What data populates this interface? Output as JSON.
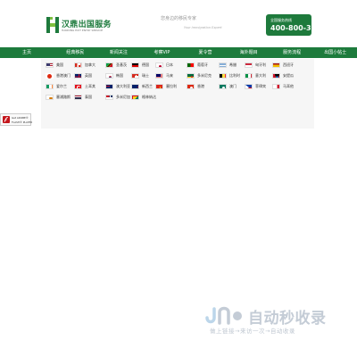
{
  "header": {
    "logo_title": "汉鼎出国服务",
    "logo_subtitle": "HANDING EXIT ENTRY SERVICE",
    "slogan": "您身边的移民专家",
    "slogan_en": "Your Immigration Expert",
    "hotline_label": "全国服务热线",
    "hotline_number": "400-800-3337"
  },
  "nav": {
    "items": [
      "主页",
      "经典移民",
      "新闻关注",
      "考察VIP",
      "夏令营",
      "海外题目",
      "服务流程",
      "出国小帖士"
    ]
  },
  "countries": [
    {
      "label": "美国",
      "flag": "us"
    },
    {
      "label": "加拿大",
      "flag": "ca"
    },
    {
      "label": "圣基茨",
      "flag": "kn"
    },
    {
      "label": "德国",
      "flag": "de"
    },
    {
      "label": "日本",
      "flag": "jp"
    },
    {
      "label": "葡萄牙",
      "flag": "pt"
    },
    {
      "label": "希腊",
      "flag": "gr"
    },
    {
      "label": "匈牙利",
      "flag": "hu"
    },
    {
      "label": "西班牙",
      "flag": "es"
    },
    {
      "label": "香港澳门",
      "flag": "hk"
    },
    {
      "label": "英国",
      "flag": "gb"
    },
    {
      "label": "韩国",
      "flag": "kr"
    },
    {
      "label": "瑞士",
      "flag": "ch"
    },
    {
      "label": "马来",
      "flag": "my"
    },
    {
      "label": "多米尼克",
      "flag": "dm"
    },
    {
      "label": "比利时",
      "flag": "be"
    },
    {
      "label": "意大利",
      "flag": "it"
    },
    {
      "label": "安提瓜",
      "flag": "ag"
    },
    {
      "label": "爱尔兰",
      "flag": "ie"
    },
    {
      "label": "土耳其",
      "flag": "tr"
    },
    {
      "label": "澳大利亚",
      "flag": "au"
    },
    {
      "label": "新西兰",
      "flag": "nz"
    },
    {
      "label": "塞拉利",
      "flag": "vn"
    },
    {
      "label": "香港",
      "flag": "hk2"
    },
    {
      "label": "澳门",
      "flag": "mo"
    },
    {
      "label": "菲律宾",
      "flag": "ph"
    },
    {
      "label": "马耳他",
      "flag": "mt"
    },
    {
      "label": "塞浦路斯",
      "flag": "cy"
    },
    {
      "label": "泰国",
      "flag": "th"
    },
    {
      "label": "多米尼加",
      "flag": "do"
    },
    {
      "label": "格林纳达",
      "flag": "gd"
    }
  ],
  "flash": {
    "line1": "Get ADOBE®",
    "line2": "FLASH® PLAYER"
  },
  "watermark": {
    "title": "自动秒收录",
    "tagline": "做上链接→来访一次→自动收录"
  }
}
